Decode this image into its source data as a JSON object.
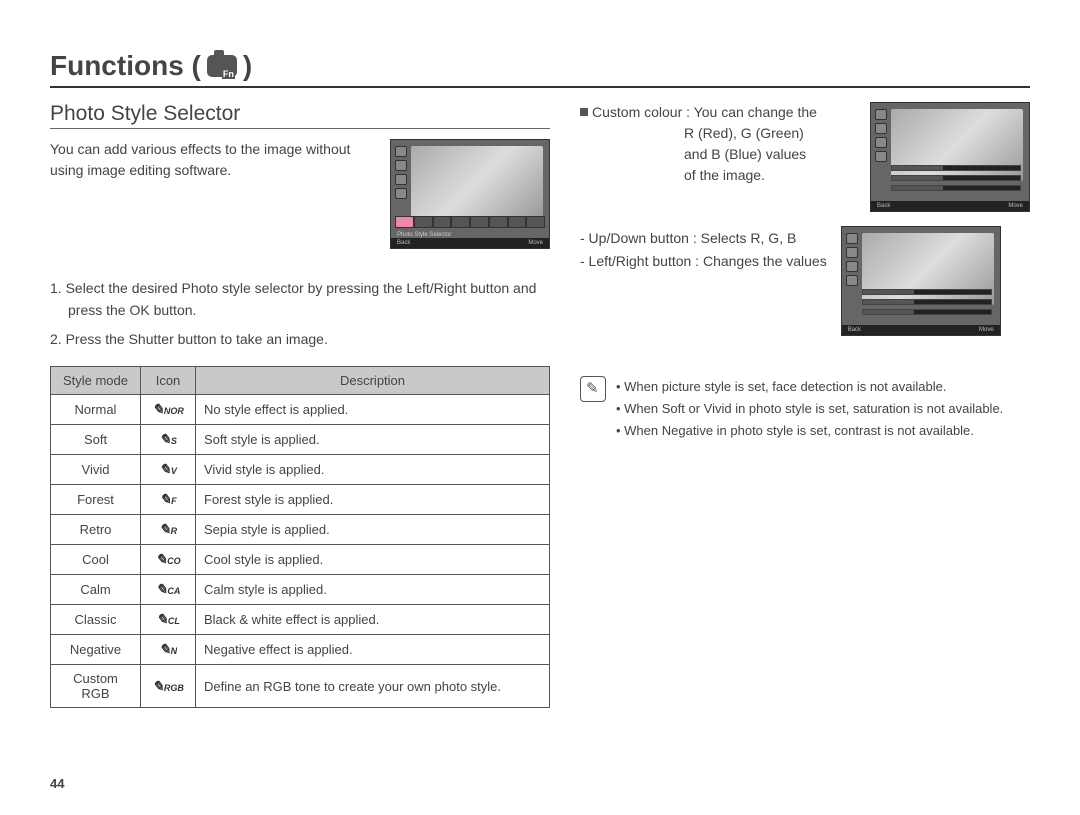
{
  "heading": "Functions (",
  "heading_close": ")",
  "section": {
    "title": "Photo Style Selector",
    "intro": "You can add various effects to the image without using image editing software.",
    "step1": "1. Select the desired Photo style selector by pressing the Left/Right button and press the OK button.",
    "step2": "2. Press the Shutter button to take an image.",
    "lcd1_label": "Photo Style Selector",
    "lcd_back": "Back",
    "lcd_move": "Move"
  },
  "table": {
    "headers": [
      "Style mode",
      "Icon",
      "Description"
    ],
    "rows": [
      {
        "mode": "Normal",
        "icon": "NOR",
        "desc": "No style effect is applied."
      },
      {
        "mode": "Soft",
        "icon": "S",
        "desc": "Soft style is applied."
      },
      {
        "mode": "Vivid",
        "icon": "V",
        "desc": "Vivid style is applied."
      },
      {
        "mode": "Forest",
        "icon": "F",
        "desc": "Forest style is applied."
      },
      {
        "mode": "Retro",
        "icon": "R",
        "desc": "Sepia style is applied."
      },
      {
        "mode": "Cool",
        "icon": "CO",
        "desc": "Cool style is applied."
      },
      {
        "mode": "Calm",
        "icon": "CA",
        "desc": "Calm style is applied."
      },
      {
        "mode": "Classic",
        "icon": "CL",
        "desc": "Black & white effect is applied."
      },
      {
        "mode": "Negative",
        "icon": "N",
        "desc": "Negative effect is applied."
      },
      {
        "mode": "Custom RGB",
        "icon": "RGB",
        "desc": "Define an RGB tone to create your own photo style."
      }
    ]
  },
  "right": {
    "custom_label": "Custom colour :",
    "custom_text": "You can change the R (Red), G (Green) and B (Blue) values of the image.",
    "b1": "- Up/Down button : Selects R, G, B",
    "b2": "- Left/Right button : Changes the values"
  },
  "notes": [
    "When picture style is set, face detection is not available.",
    "When Soft or Vivid in photo style is set, saturation is not available.",
    "When Negative in photo style is set, contrast is not available."
  ],
  "page_number": "44"
}
